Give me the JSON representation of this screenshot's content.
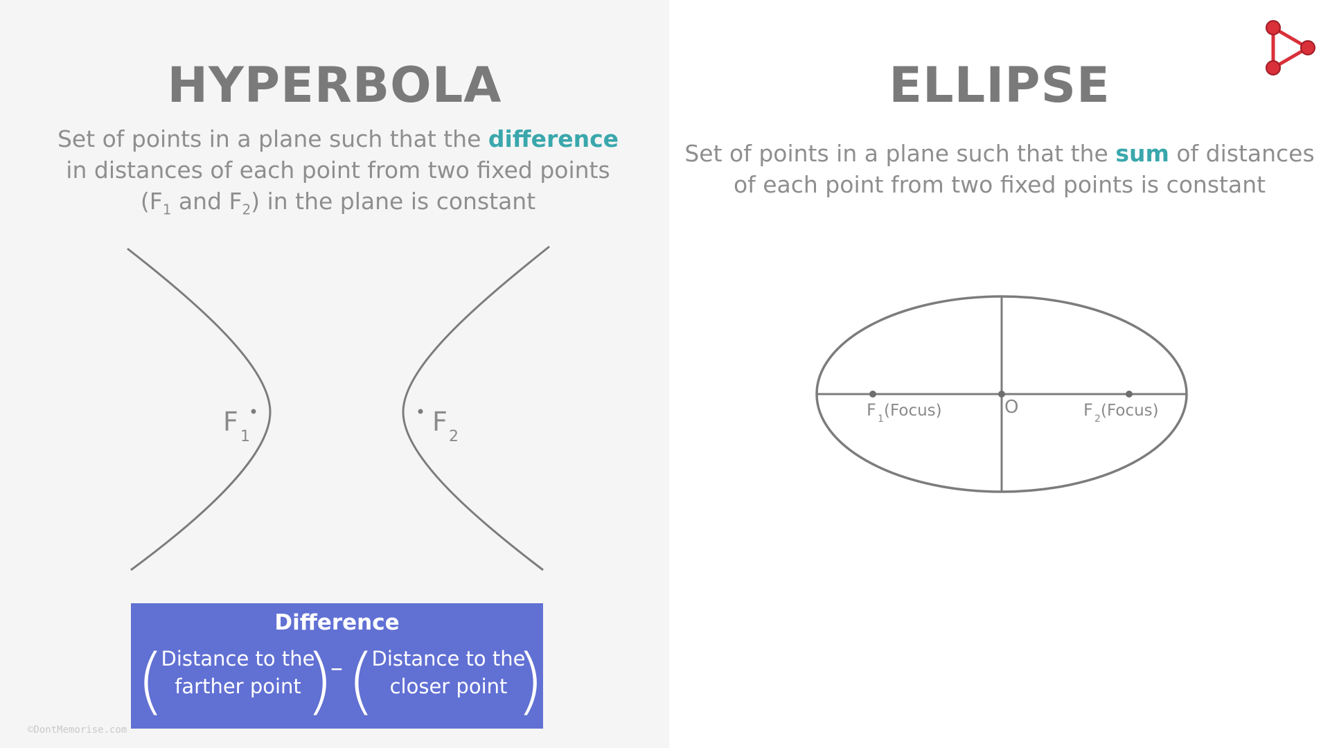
{
  "hyperbola": {
    "title": "HYPERBOLA",
    "desc_part1": "Set of points in a plane such that the ",
    "desc_highlight": "difference",
    "desc_part2": "in distances of each point from two fixed points",
    "desc_part3_open": "(F",
    "desc_sub1": "1",
    "desc_part3_mid": " and F",
    "desc_sub2": "2",
    "desc_part3_end": ") in the plane is constant",
    "focus1_label": "F",
    "focus1_sub": "1",
    "focus2_label": "F",
    "focus2_sub": "2"
  },
  "formula": {
    "title": "Difference",
    "term1": "Distance to the farther point",
    "minus": "–",
    "term2": "Distance to the closer point"
  },
  "ellipse": {
    "title": "ELLIPSE",
    "desc_part1": "Set of points in a plane such that the ",
    "desc_highlight": "sum",
    "desc_part1b": " of distances",
    "desc_part2": "of each point from two fixed points is constant",
    "focus1_label": "F",
    "focus1_sub": "1",
    "focus1_suffix": "(Focus)",
    "center_label": "O",
    "focus2_label": "F",
    "focus2_sub": "2",
    "focus2_suffix": "(Focus)"
  },
  "watermark": "©DontMemorise.com",
  "colors": {
    "accent_teal": "#3aa7ac",
    "box_blue": "#6170d3",
    "logo_red": "#d9303a",
    "title_gray": "#7a7a7a"
  },
  "icons": {
    "logo": "play-triangle-logo-icon"
  }
}
